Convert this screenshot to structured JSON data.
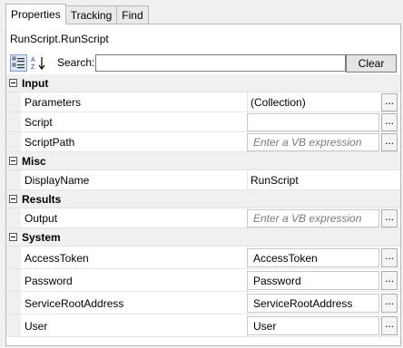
{
  "tabs": [
    "Properties",
    "Tracking",
    "Find"
  ],
  "activity_title": "RunScript.RunScript",
  "toolbar": {
    "search_label": "Search:",
    "search_value": "",
    "clear_label": "Clear"
  },
  "ellipsis_label": "...",
  "categories": [
    {
      "label": "Input",
      "rows": [
        {
          "name": "Parameters",
          "value": "(Collection)",
          "kind": "plain"
        },
        {
          "name": "Script",
          "value": "",
          "kind": "box"
        },
        {
          "name": "ScriptPath",
          "value": "Enter a VB expression",
          "kind": "hint"
        }
      ]
    },
    {
      "label": "Misc",
      "rows": [
        {
          "name": "DisplayName",
          "value": "RunScript",
          "kind": "plainnobtn"
        }
      ]
    },
    {
      "label": "Results",
      "rows": [
        {
          "name": "Output",
          "value": "Enter a VB expression",
          "kind": "hint"
        }
      ]
    },
    {
      "label": "System",
      "rows": [
        {
          "name": "AccessToken",
          "value": "AccessToken",
          "kind": "box"
        },
        {
          "name": "Password",
          "value": "Password",
          "kind": "box"
        },
        {
          "name": "ServiceRootAddress",
          "value": "ServiceRootAddress",
          "kind": "box"
        },
        {
          "name": "User",
          "value": "User",
          "kind": "box"
        }
      ]
    }
  ]
}
